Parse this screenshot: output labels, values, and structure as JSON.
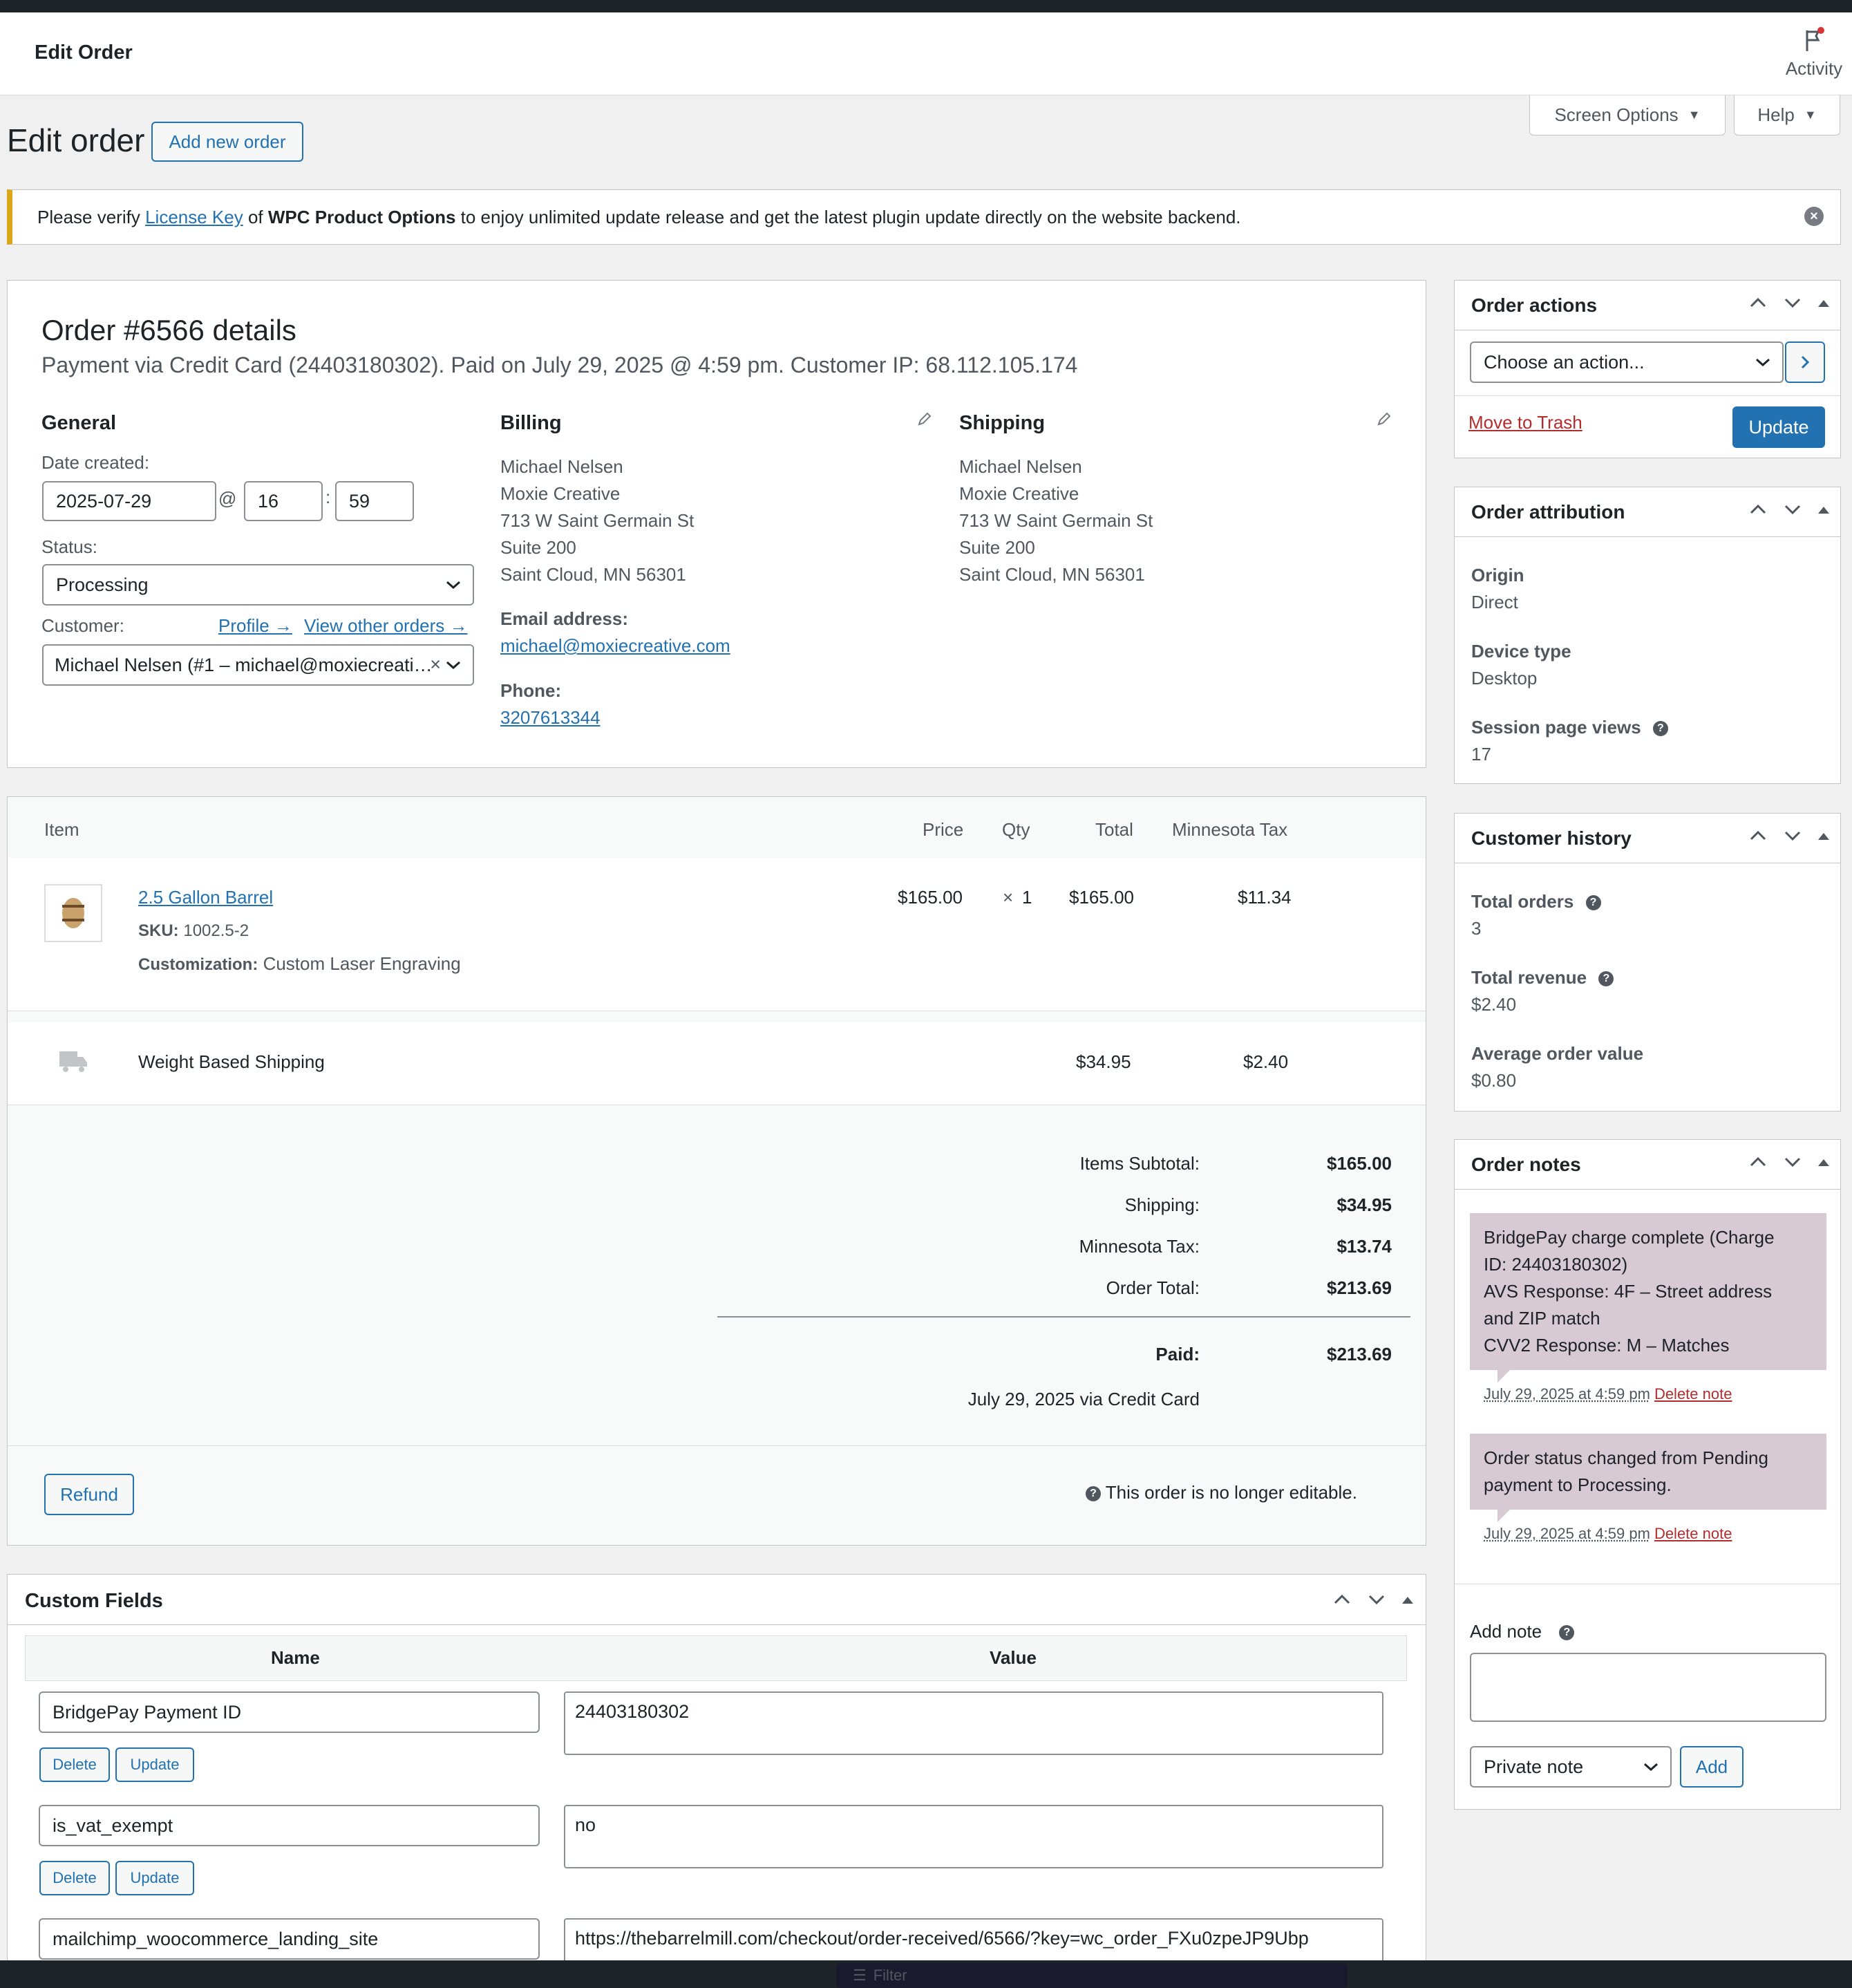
{
  "topbar": {
    "title": "Edit Order",
    "activity": "Activity"
  },
  "screen_options": "Screen Options",
  "help": "Help",
  "page": {
    "title": "Edit order",
    "add_new": "Add new order"
  },
  "notice": {
    "pre": "Please verify ",
    "link": "License Key",
    "mid": " of ",
    "plugin": "WPC Product Options",
    "post": " to enjoy unlimited update release and get the latest plugin update directly on the website backend."
  },
  "order": {
    "heading": "Order #6566 details",
    "sub": "Payment via Credit Card (24403180302). Paid on July 29, 2025 @ 4:59 pm. Customer IP: 68.112.105.174",
    "general": "General",
    "date_label": "Date created:",
    "date": "2025-07-29",
    "at": "@",
    "hour": "16",
    "colon": ":",
    "minute": "59",
    "status_label": "Status:",
    "status": "Processing",
    "customer_label": "Customer:",
    "profile": "Profile →",
    "other_orders": "View other orders →",
    "customer": "Michael Nelsen (#1 – michael@moxiecreati…",
    "clear": "×",
    "billing": {
      "title": "Billing",
      "lines": [
        "Michael Nelsen",
        "Moxie Creative",
        "713 W Saint Germain St",
        "Suite 200",
        "Saint Cloud, MN 56301"
      ],
      "email_label": "Email address:",
      "email": "michael@moxiecreative.com",
      "phone_label": "Phone:",
      "phone": "3207613344"
    },
    "shipping": {
      "title": "Shipping",
      "lines": [
        "Michael Nelsen",
        "Moxie Creative",
        "713 W Saint Germain St",
        "Suite 200",
        "Saint Cloud, MN 56301"
      ]
    }
  },
  "items": {
    "headers": {
      "item": "Item",
      "price": "Price",
      "qty": "Qty",
      "total": "Total",
      "tax": "Minnesota Tax"
    },
    "product": {
      "name": "2.5 Gallon Barrel",
      "sku_label": "SKU:",
      "sku": "1002.5-2",
      "custom_label": "Customization:",
      "custom": "Custom Laser Engraving",
      "price": "$165.00",
      "qty_x": "×",
      "qty": "1",
      "total": "$165.00",
      "tax": "$11.34"
    },
    "shipping": {
      "name": "Weight Based Shipping",
      "total": "$34.95",
      "tax": "$2.40"
    },
    "totals": [
      {
        "label": "Items Subtotal:",
        "value": "$165.00"
      },
      {
        "label": "Shipping:",
        "value": "$34.95"
      },
      {
        "label": "Minnesota Tax:",
        "value": "$13.74"
      },
      {
        "label": "Order Total:",
        "value": "$213.69"
      }
    ],
    "paid_label": "Paid:",
    "paid": "$213.69",
    "paid_via": "July 29, 2025 via Credit Card",
    "refund": "Refund",
    "not_editable": "This order is no longer editable."
  },
  "custom_fields": {
    "title": "Custom Fields",
    "name_h": "Name",
    "value_h": "Value",
    "delete": "Delete",
    "update": "Update",
    "rows": [
      {
        "name": "BridgePay Payment ID",
        "value": "24403180302"
      },
      {
        "name": "is_vat_exempt",
        "value": "no"
      },
      {
        "name": "mailchimp_woocommerce_landing_site",
        "value": "https://thebarrelmill.com/checkout/order-received/6566/?key=wc_order_FXu0zpeJP9Ubp"
      }
    ]
  },
  "order_actions": {
    "title": "Order actions",
    "choose": "Choose an action...",
    "trash": "Move to Trash",
    "update": "Update"
  },
  "attribution": {
    "title": "Order attribution",
    "origin_label": "Origin",
    "origin": "Direct",
    "device_label": "Device type",
    "device": "Desktop",
    "views_label": "Session page views",
    "views": "17"
  },
  "history": {
    "title": "Customer history",
    "orders_label": "Total orders",
    "orders": "3",
    "revenue_label": "Total revenue",
    "revenue": "$2.40",
    "aov_label": "Average order value",
    "aov": "$0.80"
  },
  "notes": {
    "title": "Order notes",
    "list": [
      {
        "lines": [
          "BridgePay charge complete (Charge",
          "ID: 24403180302)",
          "AVS Response: 4F – Street address",
          "and ZIP match",
          "CVV2 Response: M – Matches"
        ],
        "date": "July 29, 2025 at 4:59 pm",
        "delete": "Delete note"
      },
      {
        "lines": [
          "Order status changed from Pending",
          "payment to Processing."
        ],
        "date": "July 29, 2025 at 4:59 pm",
        "delete": "Delete note"
      }
    ],
    "add_label": "Add note",
    "type": "Private note",
    "add": "Add"
  },
  "bottom": {
    "filter": "Filter"
  },
  "colors": {
    "primary": "#2271b1",
    "note_bg": "#d7cad2",
    "notice_border": "#dba617",
    "danger": "#b32d2e"
  }
}
